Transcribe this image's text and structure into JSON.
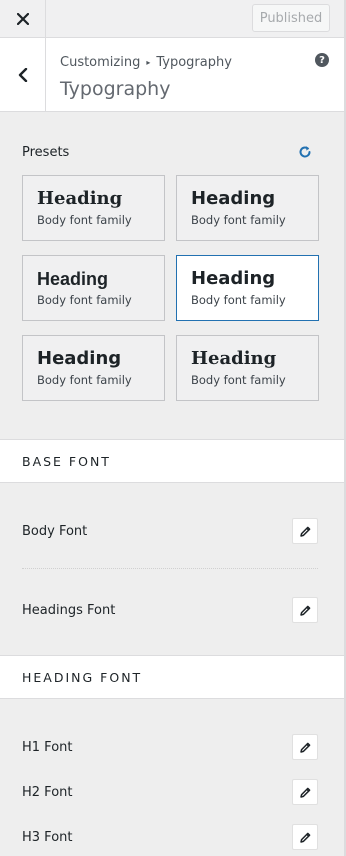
{
  "topbar": {
    "published_label": "Published"
  },
  "header": {
    "breadcrumb_root": "Customizing",
    "breadcrumb_section": "Typography",
    "title": "Typography"
  },
  "presets": {
    "title": "Presets",
    "items": [
      {
        "heading": "Heading",
        "body": "Body font family",
        "selected": false
      },
      {
        "heading": "Heading",
        "body": "Body font family",
        "selected": false
      },
      {
        "heading": "Heading",
        "body": "Body font family",
        "selected": false
      },
      {
        "heading": "Heading",
        "body": "Body font family",
        "selected": true
      },
      {
        "heading": "Heading",
        "body": "Body font family",
        "selected": false
      },
      {
        "heading": "Heading",
        "body": "Body font family",
        "selected": false
      }
    ]
  },
  "base_font": {
    "title": "BASE FONT",
    "body_font_label": "Body Font",
    "headings_font_label": "Headings Font"
  },
  "heading_font": {
    "title": "HEADING FONT",
    "h1_label": "H1 Font",
    "h2_label": "H2 Font",
    "h3_label": "H3 Font"
  },
  "colors": {
    "accent": "#2271b1"
  },
  "icons": [
    "close-icon",
    "back-chevron-icon",
    "help-icon",
    "reset-icon",
    "pencil-icon"
  ]
}
